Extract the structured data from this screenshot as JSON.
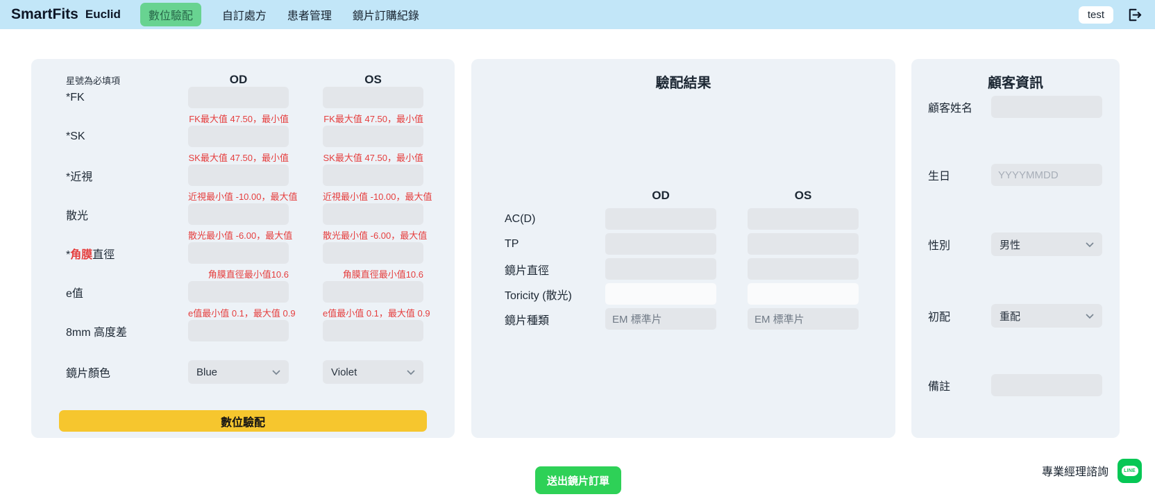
{
  "navbar": {
    "brand": "SmartFits",
    "product": "Euclid",
    "tabs": [
      {
        "label": "數位驗配",
        "active": true
      },
      {
        "label": "自訂處方",
        "active": false
      },
      {
        "label": "患者管理",
        "active": false
      },
      {
        "label": "鏡片訂購紀錄",
        "active": false
      }
    ],
    "user_badge": "test"
  },
  "fitting_form": {
    "required_note": "星號為必填項",
    "col_od": "OD",
    "col_os": "OS",
    "rows": [
      {
        "label": "*FK",
        "hint": "FK最大值 47.50，最小值"
      },
      {
        "label": "*SK",
        "hint": "SK最大值 47.50，最小值"
      },
      {
        "label": "*近視",
        "hint": "近視最小值 -10.00，最大值"
      },
      {
        "label": "散光",
        "hint": "散光最小值 -6.00，最大值"
      },
      {
        "label_prefix": "*",
        "label_red": "角膜",
        "label_rest": "直徑",
        "hint": "角膜直徑最小值10.6"
      },
      {
        "label": "e值",
        "hint": "e值最小值 0.1，最大值 0.9"
      },
      {
        "label": "8mm 高度差",
        "hint": ""
      }
    ],
    "lens_color_label": "鏡片顏色",
    "od_color_value": "Blue",
    "os_color_value": "Violet",
    "fit_button_label": "數位驗配"
  },
  "result_panel": {
    "title": "驗配結果",
    "col_od": "OD",
    "col_os": "OS",
    "rows": [
      {
        "label": "AC(D)",
        "od": "",
        "os": ""
      },
      {
        "label": "TP",
        "od": "",
        "os": ""
      },
      {
        "label": "鏡片直徑",
        "od": "",
        "os": ""
      },
      {
        "label": "Toricity (散光)",
        "od": "",
        "os": ""
      },
      {
        "label": "鏡片種類",
        "od": "EM 標準片",
        "os": "EM 標準片"
      }
    ]
  },
  "customer_panel": {
    "title": "顧客資訊",
    "name_label": "顧客姓名",
    "birthday_label": "生日",
    "birthday_placeholder": "YYYYMMDD",
    "gender_label": "性別",
    "gender_value": "男性",
    "fit_type_label": "初配",
    "fit_type_value": "重配",
    "notes_label": "備註"
  },
  "footer": {
    "submit_order_label": "送出鏡片訂單",
    "consult_label": "專業經理諮詢",
    "line_icon_label": "LINE"
  },
  "colors": {
    "navbar_bg": "#c2e6f8",
    "active_tab_bg": "#68d391",
    "active_tab_text": "#276749",
    "panel_bg": "#edf2f7",
    "field_bg": "#e3e6ea",
    "hint_red": "#e53e3e",
    "fit_button_yellow": "#f6c62e",
    "submit_button_green": "#2ed157",
    "line_green": "#06c755"
  }
}
